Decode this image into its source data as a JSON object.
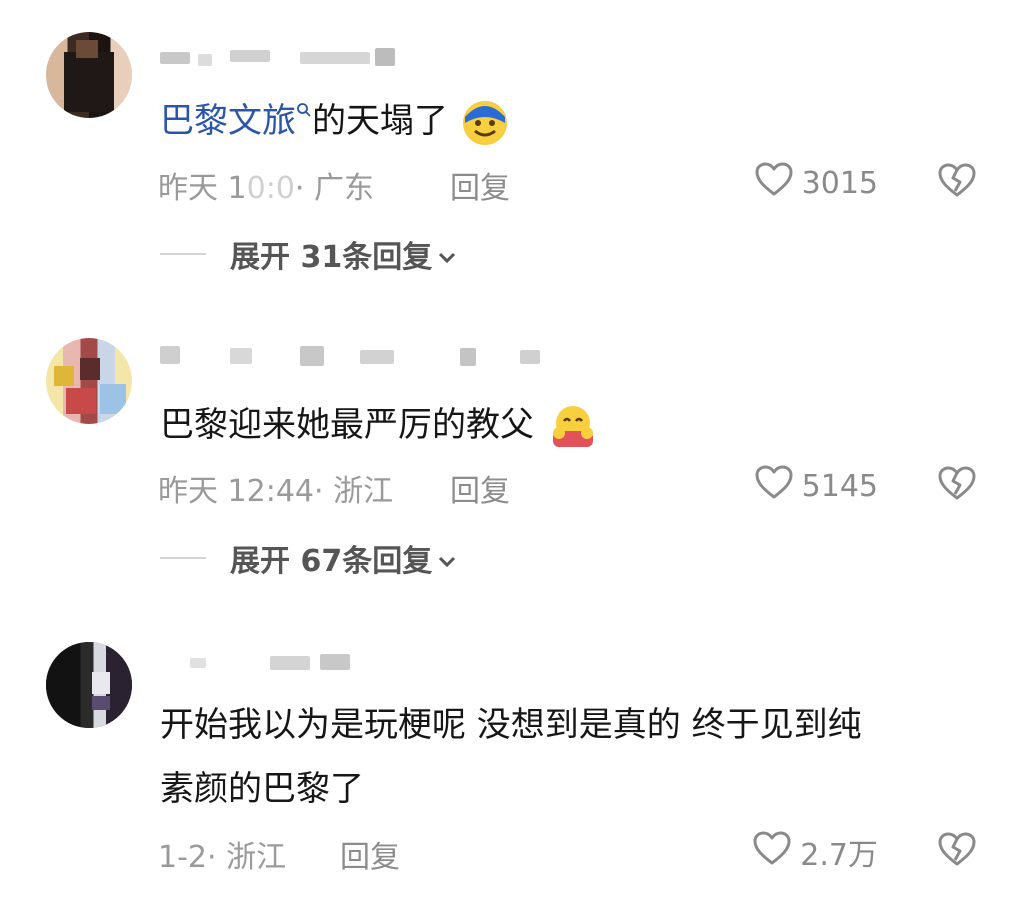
{
  "comments": [
    {
      "text_link": "巴黎文旅",
      "text_rest": "的天塌了",
      "emoji": "crying-laughing-emoji",
      "time": "昨天 1",
      "time_blurred": "0:0",
      "location": "· 广东",
      "reply_label": "回复",
      "likes": "3015",
      "expand_label": "展开 31条回复"
    },
    {
      "text": "巴黎迎来她最严厉的教父",
      "emoji": "hugging-face-emoji",
      "time": "昨天 12:44",
      "location": "· 浙江",
      "reply_label": "回复",
      "likes": "5145",
      "expand_label": "展开 67条回复"
    },
    {
      "text_line1": "开始我以为是玩梗呢  没想到是真的  终于见到纯",
      "text_line2": "素颜的巴黎了",
      "time": "1-2",
      "location": "· 浙江",
      "reply_label": "回复",
      "likes": "2.7万"
    }
  ],
  "icons": {
    "like": "heart-outline-icon",
    "dislike": "broken-heart-icon",
    "expand": "chevron-down-icon",
    "search": "search-mini-icon"
  },
  "colors": {
    "link": "#2b55a8",
    "meta": "#9a9a9a",
    "text": "#161616"
  }
}
